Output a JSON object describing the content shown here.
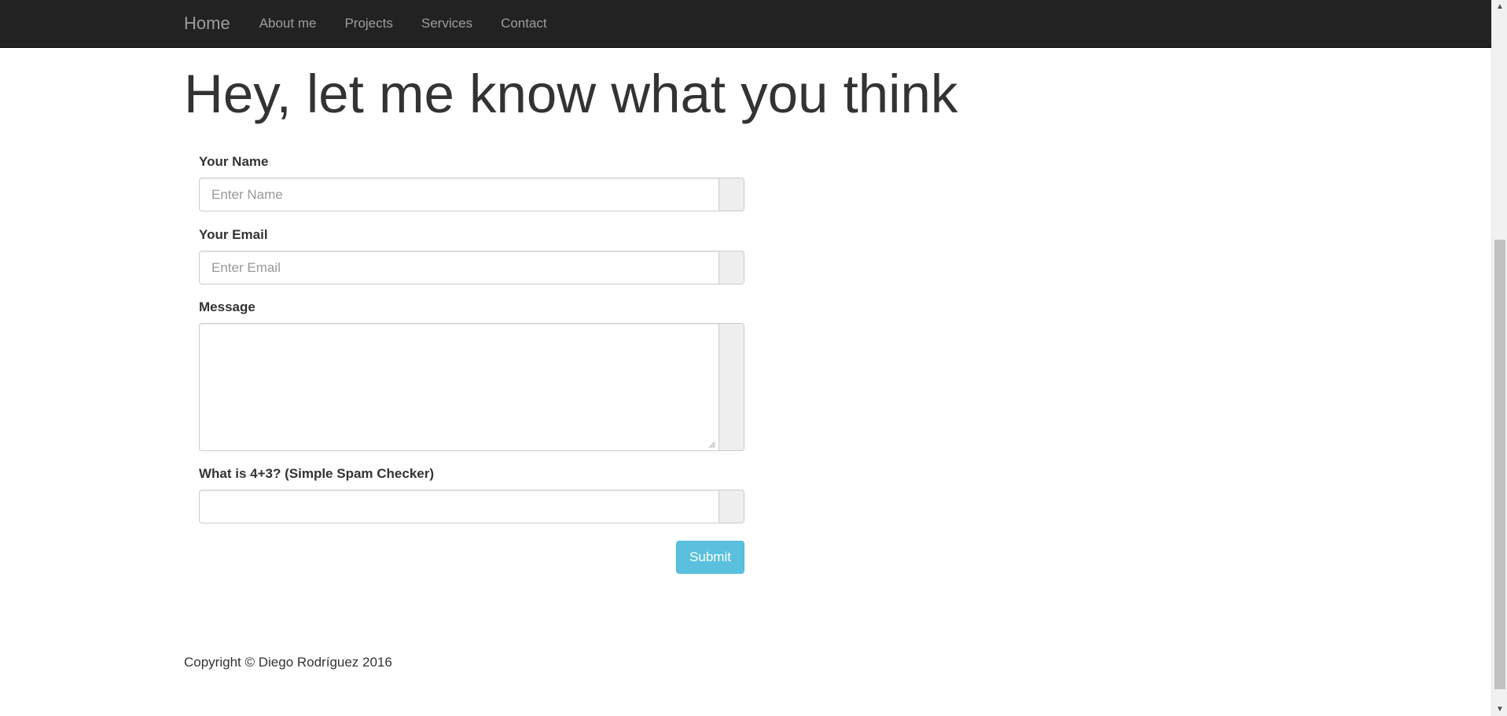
{
  "nav": {
    "brand": "Home",
    "links": [
      "About me",
      "Projects",
      "Services",
      "Contact"
    ]
  },
  "page": {
    "title": "Hey, let me know what you think"
  },
  "form": {
    "name_label": "Your Name",
    "name_placeholder": "Enter Name",
    "name_value": "",
    "email_label": "Your Email",
    "email_placeholder": "Enter Email",
    "email_value": "",
    "message_label": "Message",
    "message_value": "",
    "spam_label": "What is 4+3? (Simple Spam Checker)",
    "spam_value": "",
    "submit_label": "Submit"
  },
  "footer": {
    "copyright": "Copyright © Diego Rodríguez 2016"
  },
  "colors": {
    "navbar_bg": "#222222",
    "nav_text": "#9d9d9d",
    "submit_bg": "#5bc0de",
    "text": "#333333"
  },
  "icons": {
    "scroll_up": "scroll-up-arrow-icon",
    "scroll_down": "scroll-down-arrow-icon",
    "resize_grip": "resize-grip-icon"
  }
}
